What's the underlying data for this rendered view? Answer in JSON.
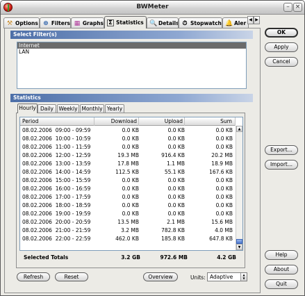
{
  "window": {
    "title": "BWMeter"
  },
  "tabs": [
    {
      "label": "Options",
      "icon": "options-icon"
    },
    {
      "label": "Filters",
      "icon": "filters-icon"
    },
    {
      "label": "Graphs",
      "icon": "graphs-icon"
    },
    {
      "label": "Statistics",
      "icon": "statistics-icon",
      "active": true
    },
    {
      "label": "Details",
      "icon": "details-icon"
    },
    {
      "label": "Stopwatch",
      "icon": "stopwatch-icon"
    },
    {
      "label": "Aler",
      "icon": "alerts-icon"
    }
  ],
  "filters": {
    "heading": "Select Filter(s)",
    "items": [
      "Internet",
      "LAN"
    ],
    "selected": "Internet"
  },
  "statistics": {
    "heading": "Statistics",
    "period_tabs": [
      "Hourly",
      "Daily",
      "Weekly",
      "Monthly",
      "Yearly"
    ],
    "active_period": "Hourly",
    "columns": {
      "period": "Period",
      "download": "Download",
      "upload": "Upload",
      "sum": "Sum"
    },
    "rows": [
      {
        "date": "08.02.2006",
        "time": "09:00 - 09:59",
        "download": "0.0 KB",
        "upload": "0.0 KB",
        "sum": "0.0 KB"
      },
      {
        "date": "08.02.2006",
        "time": "10:00 - 10:59",
        "download": "0.0 KB",
        "upload": "0.0 KB",
        "sum": "0.0 KB"
      },
      {
        "date": "08.02.2006",
        "time": "11:00 - 11:59",
        "download": "0.0 KB",
        "upload": "0.0 KB",
        "sum": "0.0 KB"
      },
      {
        "date": "08.02.2006",
        "time": "12:00 - 12:59",
        "download": "19.3 MB",
        "upload": "916.4 KB",
        "sum": "20.2 MB"
      },
      {
        "date": "08.02.2006",
        "time": "13:00 - 13:59",
        "download": "17.8 MB",
        "upload": "1.1 MB",
        "sum": "18.9 MB"
      },
      {
        "date": "08.02.2006",
        "time": "14:00 - 14:59",
        "download": "112.5 KB",
        "upload": "55.1 KB",
        "sum": "167.6 KB"
      },
      {
        "date": "08.02.2006",
        "time": "15:00 - 15:59",
        "download": "0.0 KB",
        "upload": "0.0 KB",
        "sum": "0.0 KB"
      },
      {
        "date": "08.02.2006",
        "time": "16:00 - 16:59",
        "download": "0.0 KB",
        "upload": "0.0 KB",
        "sum": "0.0 KB"
      },
      {
        "date": "08.02.2006",
        "time": "17:00 - 17:59",
        "download": "0.0 KB",
        "upload": "0.0 KB",
        "sum": "0.0 KB"
      },
      {
        "date": "08.02.2006",
        "time": "18:00 - 18:59",
        "download": "0.0 KB",
        "upload": "0.0 KB",
        "sum": "0.0 KB"
      },
      {
        "date": "08.02.2006",
        "time": "19:00 - 19:59",
        "download": "0.0 KB",
        "upload": "0.0 KB",
        "sum": "0.0 KB"
      },
      {
        "date": "08.02.2006",
        "time": "20:00 - 20:59",
        "download": "13.5 MB",
        "upload": "2.1 MB",
        "sum": "15.6 MB"
      },
      {
        "date": "08.02.2006",
        "time": "21:00 - 21:59",
        "download": "3.2 MB",
        "upload": "782.8 KB",
        "sum": "4.0 MB"
      },
      {
        "date": "08.02.2006",
        "time": "22:00 - 22:59",
        "download": "462.0 KB",
        "upload": "185.8 KB",
        "sum": "647.8 KB"
      }
    ],
    "totals": {
      "label": "Selected Totals",
      "download": "3.2 GB",
      "upload": "972.6 MB",
      "sum": "4.2 GB"
    }
  },
  "bottom": {
    "refresh": "Refresh",
    "reset": "Reset",
    "overview": "Overview",
    "units_label": "Units:",
    "units_value": "Adaptive"
  },
  "side_buttons": {
    "ok": "OK",
    "apply": "Apply",
    "cancel": "Cancel",
    "export": "Export...",
    "import": "Import...",
    "help": "Help",
    "about": "About",
    "quit": "Quit"
  }
}
